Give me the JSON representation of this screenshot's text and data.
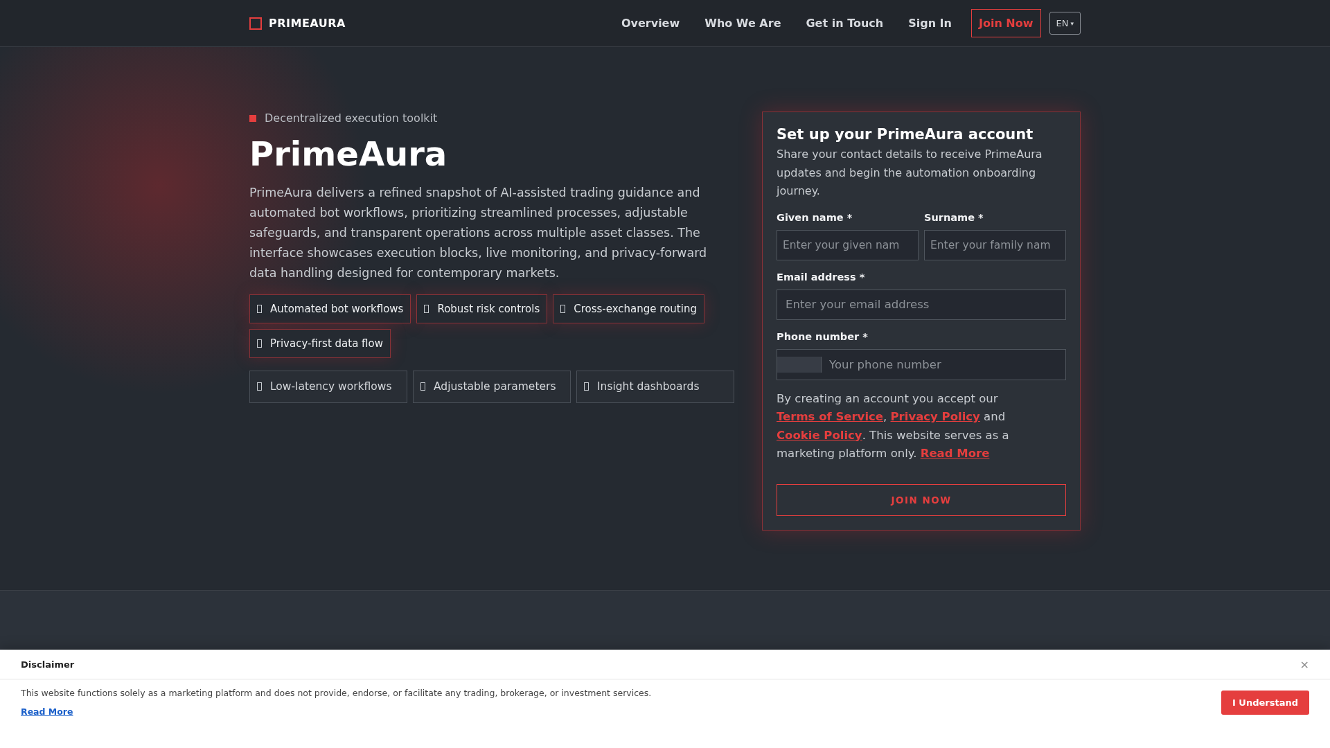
{
  "header": {
    "brand": "PRIMEAURA",
    "nav": [
      {
        "label": "Overview",
        "kind": "link"
      },
      {
        "label": "Who We Are",
        "kind": "link"
      },
      {
        "label": "Get in Touch",
        "kind": "link"
      },
      {
        "label": "Sign In",
        "kind": "link"
      },
      {
        "label": "Join Now",
        "kind": "cta"
      }
    ],
    "language": {
      "label": "EN",
      "caret": "▾"
    }
  },
  "hero": {
    "eyebrow": "Decentralized execution toolkit",
    "title": "PrimeAura",
    "description": "PrimeAura delivers a refined snapshot of AI-assisted trading guidance and automated bot workflows, prioritizing streamlined processes, adjustable safeguards, and transparent operations across multiple asset classes. The interface showcases execution blocks, live monitoring, and privacy-forward data handling designed for contemporary markets.",
    "highlights": [
      "Automated bot workflows",
      "Robust risk controls",
      "Cross-exchange routing",
      "Privacy-first data flow"
    ],
    "features": [
      "Low-latency workflows",
      "Adjustable parameters",
      "Insight dashboards"
    ]
  },
  "signup_form": {
    "title": "Set up your PrimeAura account",
    "intro": "Share your contact details to receive PrimeAura updates and begin the automation onboarding journey.",
    "fields": [
      {
        "label": "Given name *",
        "placeholder": "Enter your given nam",
        "kind": "half"
      },
      {
        "label": "Surname *",
        "placeholder": "Enter your family nam",
        "kind": "half"
      },
      {
        "label": "Email address *",
        "placeholder": "Enter your email address",
        "kind": "full"
      },
      {
        "label": "Phone number *",
        "placeholder": "Your phone number",
        "kind": "phone"
      }
    ],
    "consent": [
      {
        "text": "By creating an account you accept our ",
        "kind": "text"
      },
      {
        "text": "Terms of Service",
        "kind": "link"
      },
      {
        "text": ", ",
        "kind": "text"
      },
      {
        "text": "Privacy Policy",
        "kind": "link"
      },
      {
        "text": " and ",
        "kind": "text"
      },
      {
        "text": "Cookie Policy",
        "kind": "link"
      },
      {
        "text": ". This website serves as a marketing platform only. ",
        "kind": "text"
      },
      {
        "text": "Read More",
        "kind": "link"
      }
    ],
    "submit": "JOIN NOW"
  },
  "disclaimer": {
    "title": "Disclaimer",
    "close": "×",
    "text": "This website functions solely as a marketing platform and does not provide, endorse, or facilitate any trading, brokerage, or investment services.",
    "link": "Read More",
    "button": "I Understand"
  }
}
